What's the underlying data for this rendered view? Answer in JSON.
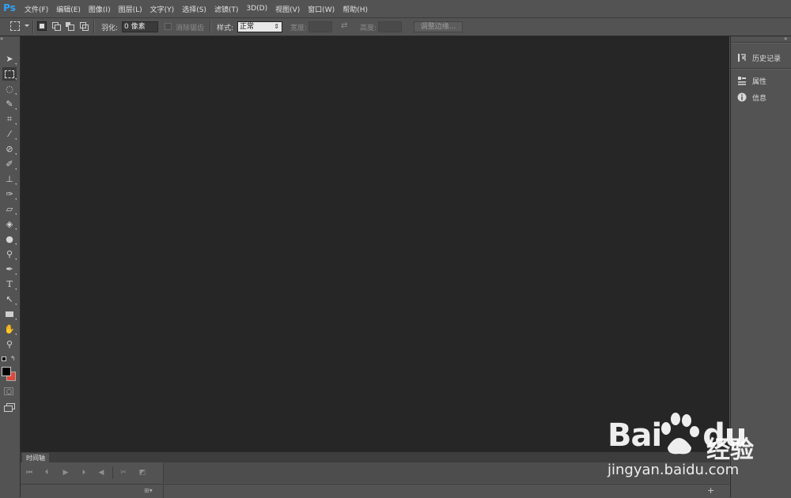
{
  "app": {
    "logo": "Ps"
  },
  "menu": [
    "文件(F)",
    "编辑(E)",
    "图像(I)",
    "图层(L)",
    "文字(Y)",
    "选择(S)",
    "滤镜(T)",
    "3D(D)",
    "视图(V)",
    "窗口(W)",
    "帮助(H)"
  ],
  "options": {
    "feather_label": "羽化:",
    "feather_value": "0 像素",
    "antialias_label": "消除锯齿",
    "style_label": "样式:",
    "style_value": "正常",
    "width_label": "宽度:",
    "height_label": "高度:",
    "refine_edge_label": "调整边缘..."
  },
  "timeline": {
    "tab_label": "时间轴"
  },
  "panels": {
    "history": "历史记录",
    "properties": "属性",
    "info": "信息"
  },
  "watermark": {
    "brand": "Bai",
    "brand2": "du",
    "cn": "经验",
    "url": "jingyan.baidu.com"
  },
  "colors": {
    "accent": "#2fa3f7",
    "background_swatch": "#e0473a",
    "foreground_swatch": "#000000"
  }
}
